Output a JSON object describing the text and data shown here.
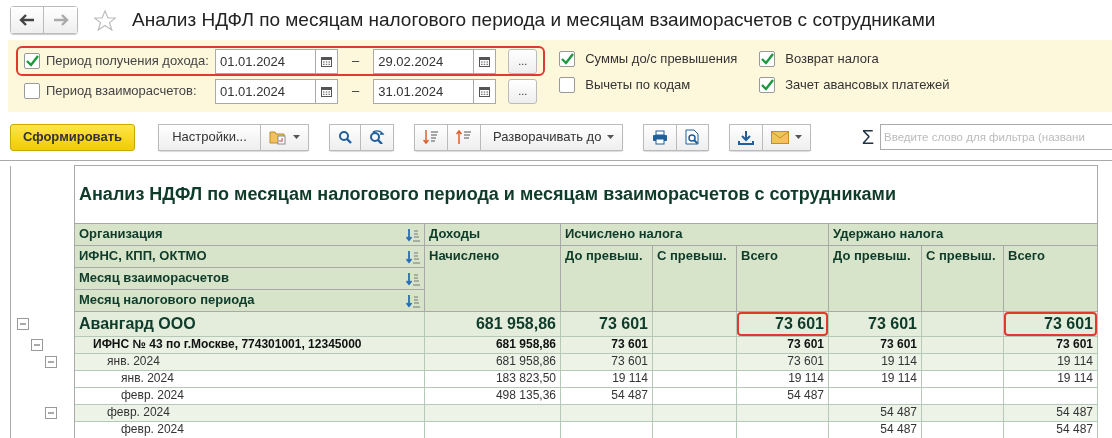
{
  "window": {
    "title": "Анализ НДФЛ по месяцам налогового периода и месяцам взаиморасчетов с сотрудниками"
  },
  "filters": [
    {
      "label": "Период получения дохода:",
      "checked": true,
      "from": "01.01.2024",
      "to": "29.02.2024",
      "dash": "–",
      "more_button": "...",
      "highlighted": true
    },
    {
      "label": "Период взаиморасчетов:",
      "checked": false,
      "from": "01.01.2024",
      "to": "31.01.2024",
      "dash": "–",
      "more_button": "...",
      "highlighted": false
    }
  ],
  "options": [
    {
      "label": "Суммы до/с превышения",
      "checked": true
    },
    {
      "label": "Вычеты по кодам",
      "checked": false
    },
    {
      "label": "Возврат налога",
      "checked": true
    },
    {
      "label": "Зачет авансовых платежей",
      "checked": true
    }
  ],
  "toolbar": {
    "generate_button": "Сформировать",
    "settings_button": "Настройки...",
    "expand_button": "Разворачивать до",
    "sum_symbol": "Σ",
    "search": {
      "placeholder": "Введите слово для фильтра (названи"
    }
  },
  "report": {
    "title": "Анализ НДФЛ по месяцам налогового периода и месяцам взаиморасчетов с сотрудниками",
    "groupings": [
      "Организация",
      "ИФНС, КПП, ОКТМО",
      "Месяц взаиморасчетов",
      "Месяц налогового периода"
    ],
    "column_groups": [
      {
        "label": "Доходы",
        "columns": [
          "Начислено"
        ]
      },
      {
        "label": "Исчислено налога",
        "columns": [
          "До превыш.",
          "С превыш.",
          "Всего"
        ]
      },
      {
        "label": "Удержано налога",
        "columns": [
          "До превыш.",
          "С превыш.",
          "Всего"
        ]
      }
    ],
    "rows": [
      {
        "label": "Авангард ООО",
        "expanded": true,
        "values": {
          "income_accrued": "681 958,86",
          "calculated_before": "73 601",
          "calculated_total": "73 601",
          "withheld_before": "73 601",
          "withheld_total": "73 601"
        },
        "highlighted": {
          "income_accrued": false,
          "calculated_before": false,
          "calculated_over": false,
          "calculated_total": true,
          "withheld_before": false,
          "withheld_over": false,
          "withheld_total": true
        },
        "children": [
          {
            "label": "ИФНС № 43 по г.Москве, 774301001, 12345000",
            "expanded": true,
            "values": {
              "income_accrued": "681 958,86",
              "calculated_before": "73 601",
              "calculated_total": "73 601",
              "withheld_before": "73 601",
              "withheld_total": "73 601"
            },
            "children": [
              {
                "label": "янв. 2024",
                "expanded": true,
                "values": {
                  "income_accrued": "681 958,86",
                  "calculated_before": "73 601",
                  "calculated_total": "73 601",
                  "withheld_before": "19 114",
                  "withheld_total": "19 114"
                },
                "children": [
                  {
                    "label": "янв. 2024",
                    "values": {
                      "income_accrued": "183 823,50",
                      "calculated_before": "19 114",
                      "calculated_total": "19 114",
                      "withheld_before": "19 114",
                      "withheld_total": "19 114"
                    }
                  },
                  {
                    "label": "февр. 2024",
                    "values": {
                      "income_accrued": "498 135,36",
                      "calculated_before": "54 487",
                      "calculated_total": "54 487"
                    }
                  }
                ]
              },
              {
                "label": "февр. 2024",
                "expanded": true,
                "values": {
                  "withheld_before": "54 487",
                  "withheld_total": "54 487"
                },
                "children": [
                  {
                    "label": "февр. 2024",
                    "values": {
                      "withheld_before": "54 487",
                      "withheld_total": "54 487"
                    }
                  }
                ]
              }
            ]
          }
        ]
      }
    ]
  }
}
